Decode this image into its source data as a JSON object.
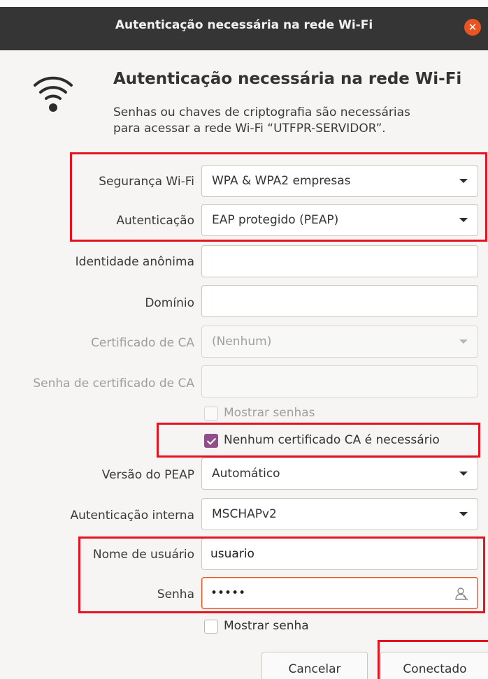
{
  "window": {
    "title": "Autenticação necessária na rede Wi-Fi",
    "close_icon": "close-icon"
  },
  "dialog": {
    "icon": "wifi-icon",
    "heading": "Autenticação necessária na rede Wi-Fi",
    "description_line1": "Senhas ou chaves de criptografia são necessárias",
    "description_line2": "para acessar a rede Wi-Fi “UTFPR-SERVIDOR”."
  },
  "form": {
    "wifi_security": {
      "label": "Segurança Wi-Fi",
      "value": "WPA & WPA2 empresas"
    },
    "authentication": {
      "label": "Autenticação",
      "value": "EAP protegido (PEAP)"
    },
    "anonymous_identity": {
      "label": "Identidade anônima",
      "value": ""
    },
    "domain": {
      "label": "Domínio",
      "value": ""
    },
    "ca_certificate": {
      "label": "Certificado de CA",
      "value": "(Nenhum)"
    },
    "ca_cert_password": {
      "label": "Senha de certificado de CA",
      "value": ""
    },
    "show_passwords": {
      "label": "Mostrar senhas",
      "checked": false
    },
    "no_ca_required": {
      "label": "Nenhum certificado CA é necessário",
      "checked": true
    },
    "peap_version": {
      "label": "Versão do PEAP",
      "value": "Automático"
    },
    "inner_auth": {
      "label": "Autenticação interna",
      "value": "MSCHAPv2"
    },
    "username": {
      "label": "Nome de usuário",
      "value": "usuario"
    },
    "password": {
      "label": "Senha",
      "value": "•••••"
    },
    "show_password": {
      "label": "Mostrar senha",
      "checked": false
    }
  },
  "buttons": {
    "cancel": "Cancelar",
    "connect": "Conectado"
  },
  "colors": {
    "highlight": "#e5121f",
    "accent": "#e95420",
    "checkbox": "#924d8b",
    "titlebar": "#353535"
  }
}
